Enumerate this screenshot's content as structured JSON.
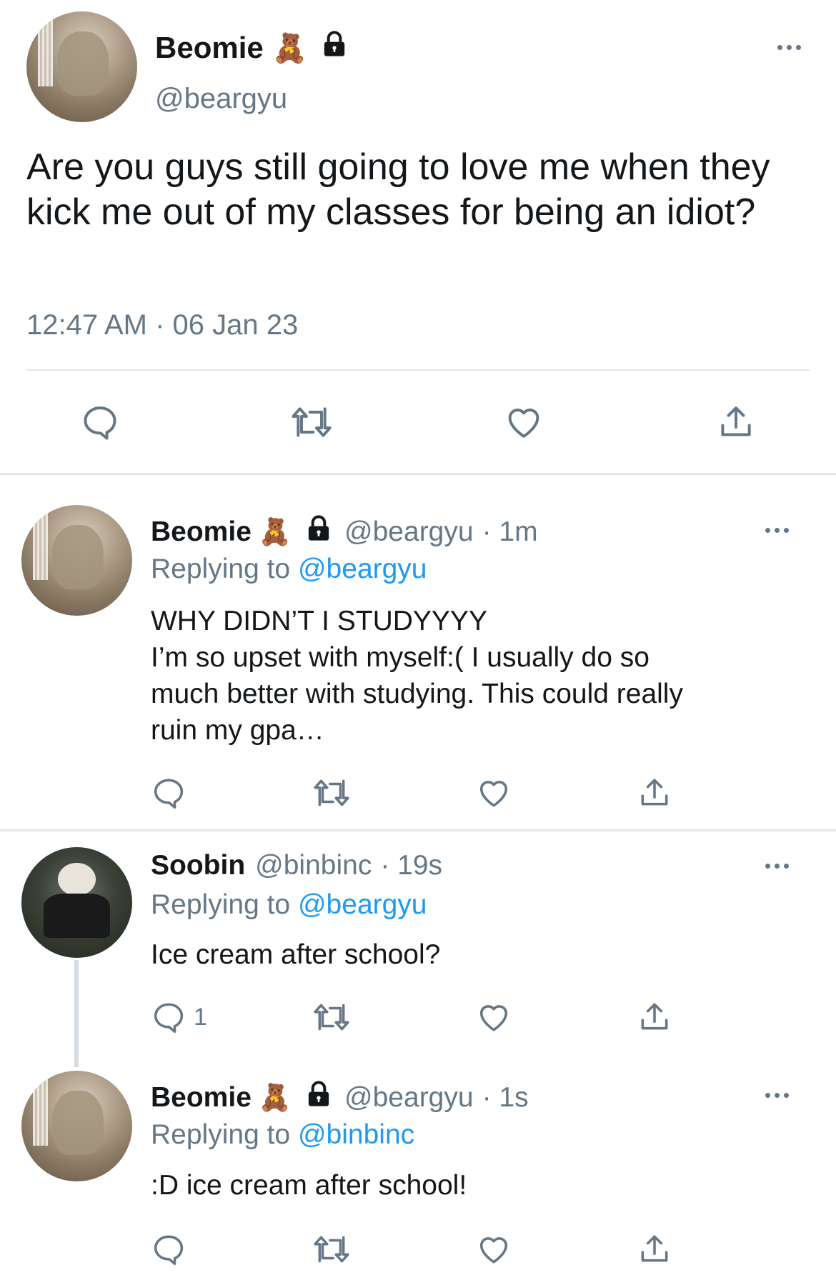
{
  "main_tweet": {
    "display_name": "Beomie",
    "name_emoji": "🧸",
    "handle": "@beargyu",
    "text": "Are you guys still going to love me when they kick me out of my classes for being an idiot?",
    "timestamp": "12:47 AM · 06 Jan 23",
    "icons": [
      "reply-icon",
      "retweet-icon",
      "like-icon",
      "share-icon",
      "lock-icon",
      "more-icon"
    ]
  },
  "replies": [
    {
      "display_name": "Beomie",
      "name_emoji": "🧸",
      "handle": "@beargyu",
      "time": "· 1m",
      "replying_prefix": "Replying to",
      "replying_to": "@beargyu",
      "text_lines": [
        "WHY DIDN’T I STUDYYYY",
        "I’m so upset with myself:( I usually do so",
        "much better with studying. This could really",
        "ruin my gpa…"
      ],
      "reply_count": ""
    },
    {
      "display_name": "Soobin",
      "handle": "@binbinc",
      "time": "· 19s",
      "replying_prefix": "Replying to",
      "replying_to": "@beargyu",
      "text_lines": [
        "Ice cream after school?"
      ],
      "reply_count": "1"
    },
    {
      "display_name": "Beomie",
      "name_emoji": "🧸",
      "handle": "@beargyu",
      "time": "· 1s",
      "replying_prefix": "Replying to",
      "replying_to": "@binbinc",
      "text_lines": [
        ":D ice cream after school!"
      ],
      "reply_count": ""
    }
  ],
  "colors": {
    "text": "#14171a",
    "muted": "#657786",
    "link": "#1d9bf0",
    "divider": "#e1e8ed"
  }
}
